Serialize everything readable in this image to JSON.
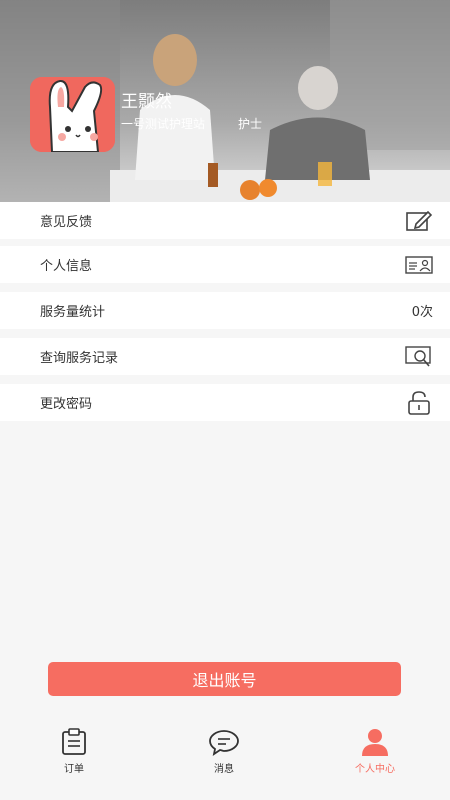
{
  "profile": {
    "name": "王颢然",
    "station": "一号测试护理站",
    "role": "护士"
  },
  "menu": [
    {
      "label": "意见反馈",
      "icon": "edit-icon"
    },
    {
      "label": "个人信息",
      "icon": "id-card-icon"
    },
    {
      "label": "服务量统计",
      "value": "0次"
    },
    {
      "label": "查询服务记录",
      "icon": "search-record-icon"
    },
    {
      "label": "更改密码",
      "icon": "unlock-icon"
    }
  ],
  "logout_label": "退出账号",
  "tabs": [
    {
      "label": "订单",
      "icon": "clipboard-icon",
      "active": false
    },
    {
      "label": "消息",
      "icon": "chat-bubble-icon",
      "active": false
    },
    {
      "label": "个人中心",
      "icon": "person-icon",
      "active": true
    }
  ],
  "colors": {
    "accent": "#f66d61",
    "avatar_bg": "#f0685e"
  }
}
